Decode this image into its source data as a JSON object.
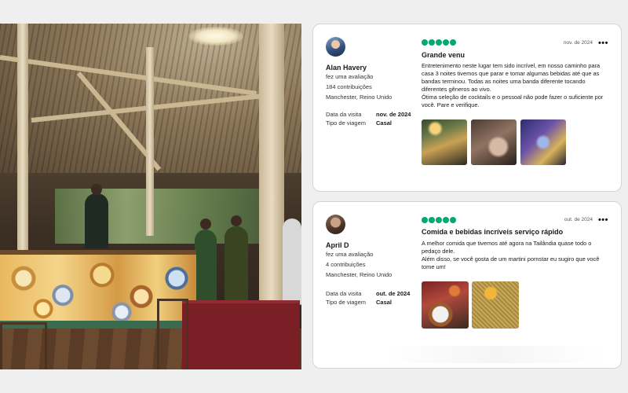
{
  "photo": {
    "alt": ""
  },
  "reviews": [
    {
      "user_name": "Alan Havery",
      "action": "fez uma avaliação",
      "contributions": "184 contribuições",
      "location": "Manchester, Reino Unido",
      "visit_label": "Data da visita",
      "visit_value": "nov. de 2024",
      "trip_label": "Tipo de viagem",
      "trip_value": "Casal",
      "rating": 5,
      "date": "nov. de 2024",
      "more": "•••",
      "title": "Grande venu",
      "body": "Entretenimento neste lugar tem sido incrível, em nosso caminho para casa 3 noites tivemos que parar e tomar algumas bebidas até que as bandas terminou. Todas as noites uma banda diferente tocando diferentes gêneros ao vivo.\nÓtima seleção de cocktails e o pessoal não pode fazer o suficiente por você. Pare e verifique.",
      "photos": [
        "review-photo-1",
        "review-photo-2",
        "review-photo-3"
      ]
    },
    {
      "user_name": "April D",
      "action": "fez uma avaliação",
      "contributions": "4 contribuições",
      "location": "Manchester, Reino Unido",
      "visit_label": "Data da visita",
      "visit_value": "out. de 2024",
      "trip_label": "Tipo de viagem",
      "trip_value": "Casal",
      "rating": 5,
      "date": "out. de 2024",
      "more": "•••",
      "title": "Comida e bebidas incríveis serviço rápido",
      "body": "A melhor comida que tivemos até agora na Tailândia quase todo o pedaço dele.\n Além disso, se você gosta de um martini pornstar eu sugiro que você tome um!",
      "photos": [
        "review-photo-1",
        "review-photo-2"
      ]
    }
  ],
  "colors": {
    "star": "#00aa6c",
    "card_border": "#d4d4d4",
    "background": "#efefef"
  }
}
